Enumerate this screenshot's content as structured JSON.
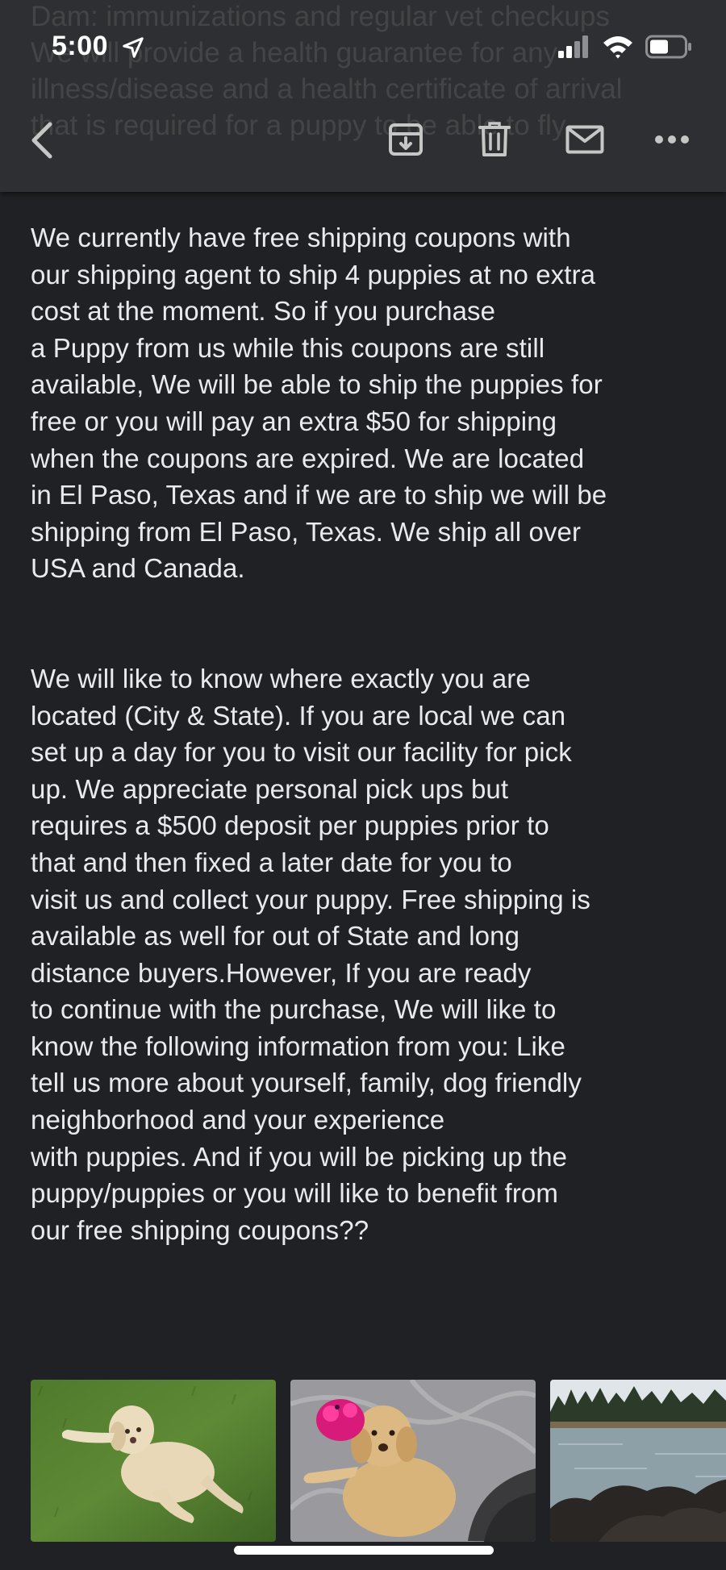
{
  "status_bar": {
    "time": "5:00"
  },
  "header_ghost_text": "Dam: immunizations and regular vet checkups\nWe will provide a health guarantee for any illness/disease and a health certificate of arrival\nthat is required for a puppy to be able to fly",
  "toolbar": {
    "back_icon": "chevron-left-icon",
    "archive_icon": "archive-icon",
    "delete_icon": "trash-icon",
    "mark_unread_icon": "mail-icon",
    "more_icon": "more-horizontal-icon"
  },
  "email_body": {
    "paragraphs": [
      "We currently have free shipping coupons with\nour shipping agent to ship 4 puppies at no extra\ncost at the moment. So if you purchase\na Puppy  from us while this coupons are still\navailable, We will be able to ship the puppies for\nfree or you will pay an extra $50 for shipping\nwhen the coupons are expired. We are located\nin El Paso, Texas and if we are to ship we will be\nshipping from El Paso, Texas. We ship all over\nUSA and Canada.",
      "We will like to know where exactly you are\nlocated (City & State). If you are local we can\nset up a day for you to visit our facility for pick\nup. We appreciate personal pick ups but\nrequires a $500 deposit per puppies prior to\nthat and then fixed a later date for you to\nvisit us and collect your puppy. Free shipping is\navailable as well for out of State and long\ndistance buyers.However, If you are ready\nto continue with the purchase, We will like to\nknow the following information from you: Like\ntell us more about yourself, family, dog friendly\nneighborhood and your experience\nwith puppies. And if you will be picking up the\npuppy/puppies  or you will like to benefit from\nour free shipping coupons??"
    ]
  },
  "attachments": [
    {
      "name": "puppy-on-grass-photo"
    },
    {
      "name": "puppy-with-toy-photo"
    },
    {
      "name": "lake-shore-photo"
    }
  ],
  "colors": {
    "background": "#202124",
    "toolbar": "#2e2f32",
    "text": "#e8eaed",
    "icon": "#c4c7c5"
  }
}
